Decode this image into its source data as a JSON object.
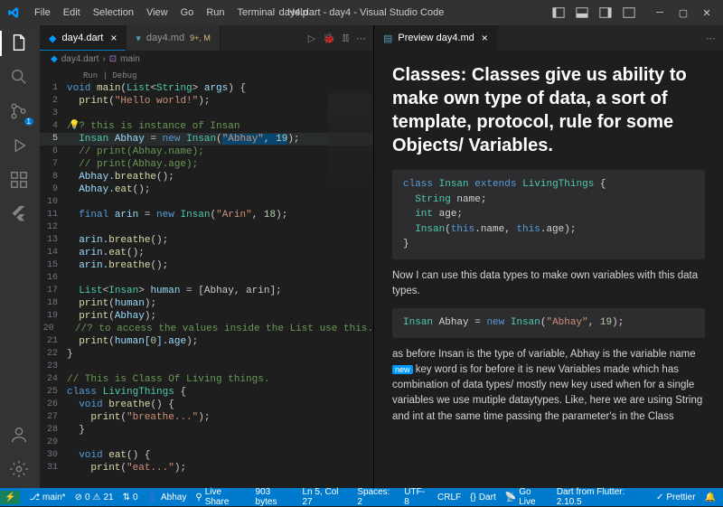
{
  "window": {
    "title": "day4.dart - day4 - Visual Studio Code"
  },
  "menu": {
    "items": [
      "File",
      "Edit",
      "Selection",
      "View",
      "Go",
      "Run",
      "Terminal",
      "Help"
    ]
  },
  "activitybar": {
    "badge_scm": "1"
  },
  "editor_left": {
    "tabs": [
      {
        "label": "day4.dart",
        "active": true
      },
      {
        "label": "day4.md",
        "mod": "9+, M",
        "active": false
      }
    ],
    "breadcrumb": [
      "day4.dart",
      "main"
    ],
    "codelens": "Run | Debug",
    "lines": {
      "l1": "void main(List<String> args) {",
      "l2a": "print",
      "l2b": "\"Hello world!\"",
      "l4": "//? this is instance of Insan",
      "l5a": "Insan",
      "l5b": "Abhay",
      "l5c": "new",
      "l5d": "Insan",
      "l5e": "\"Abhay\"",
      "l5f": "19",
      "l6": "// print(Abhay.name);",
      "l7": "// print(Abhay.age);",
      "l8a": "Abhay.",
      "l8b": "breathe",
      "l9a": "Abhay.",
      "l9b": "eat",
      "l11a": "final",
      "l11b": "arin",
      "l11c": "new",
      "l11d": "Insan",
      "l11e": "\"Arin\"",
      "l11f": "18",
      "l13a": "arin.",
      "l13b": "breathe",
      "l14a": "arin.",
      "l14b": "eat",
      "l15a": "arin.",
      "l15b": "breathe",
      "l17a": "List",
      "l17b": "Insan",
      "l17c": "human",
      "l17d": "[Abhay, arin]",
      "l18a": "print",
      "l18b": "human",
      "l19a": "print",
      "l19b": "Abhay",
      "l20": "//? to access the values inside the List use this.",
      "l21a": "print",
      "l21b": "human[",
      "l21c": "0",
      "l21d": "].age",
      "l24": "// This is Class Of Living things.",
      "l25a": "class",
      "l25b": "LivingThings",
      "l26a": "void",
      "l26b": "breathe",
      "l27a": "print",
      "l27b": "\"breathe...\"",
      "l30a": "void",
      "l30b": "eat",
      "l31a": "print",
      "l31b": "\"eat...\""
    },
    "current_line": 5
  },
  "editor_right": {
    "tab": {
      "label": "Preview day4.md"
    },
    "h1": "Classes: Classes give us ability to make own type of data, a sort of template, protocol, rule for some Objects/ Variables.",
    "code1": "class Insan extends LivingThings {\n  String name;\n  int age;\n  Insan(this.name, this.age);\n}",
    "p1": "Now I can use this data types to make own variables with this data types.",
    "code2": "Insan Abhay = new Insan(\"Abhay\", 19);",
    "p2a": "as before Insan is the type of variable, Abhay is the variable name ",
    "p2b": " key word is for before it is new Variables made which has combination of data types/ mostly new key used when for a single variables we use mutiple dataytypes. Like, here we are using String and int at the same time passing the parameter's in the Class",
    "badge": "new"
  },
  "status": {
    "branch": "main*",
    "errors": "0",
    "warnings": "21",
    "port": "0",
    "user": "Abhay",
    "liveshare": "Live Share",
    "bytes": "903 bytes",
    "cursor": "Ln 5, Col 27",
    "spaces": "Spaces: 2",
    "encoding": "UTF-8",
    "eol": "CRLF",
    "lang": "Dart",
    "golive": "Go Live",
    "flutter": "Dart from Flutter: 2.10.5",
    "prettier": "Prettier"
  }
}
